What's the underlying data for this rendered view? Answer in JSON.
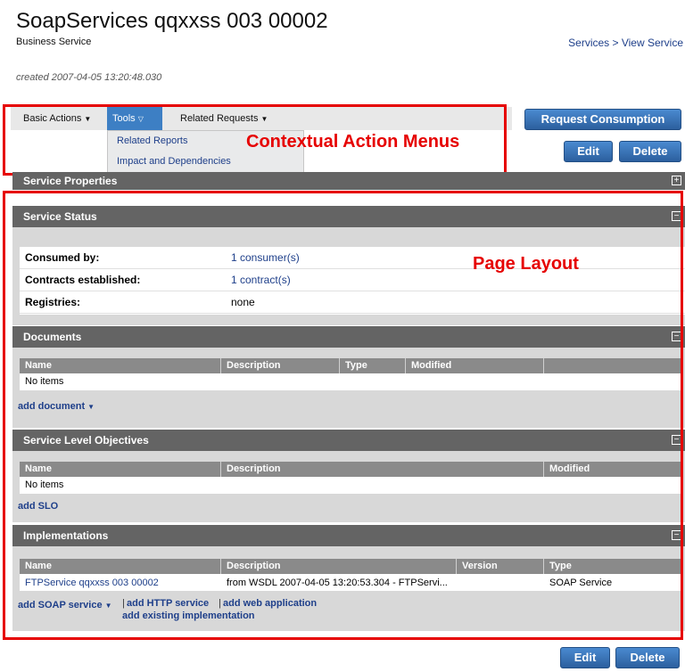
{
  "header": {
    "title": "SoapServices qqxxss 003 00002",
    "subtitle": "Business Service",
    "breadcrumb": "Services > View Service",
    "created": "created 2007-04-05 13:20:48.030"
  },
  "menus": {
    "basic_actions": "Basic Actions",
    "tools": "Tools",
    "related_requests": "Related Requests",
    "tools_items": [
      "Related Reports",
      "Impact and Dependencies"
    ]
  },
  "buttons": {
    "request_consumption": "Request Consumption",
    "edit": "Edit",
    "delete": "Delete"
  },
  "annotations": {
    "contextual": "Contextual Action Menus",
    "layout": "Page Layout"
  },
  "sections": {
    "service_properties": "Service Properties",
    "service_status": "Service Status",
    "documents": "Documents",
    "slo": "Service Level Objectives",
    "implementations": "Implementations"
  },
  "status": [
    {
      "key": "Consumed by:",
      "value": "1 consumer(s)"
    },
    {
      "key": "Contracts established:",
      "value": "1 contract(s)"
    },
    {
      "key": "Registries:",
      "value": "none"
    }
  ],
  "documents": {
    "columns": [
      "Name",
      "Description",
      "Type",
      "Modified"
    ],
    "empty": "No items",
    "add": "add document"
  },
  "slo": {
    "columns": [
      "Name",
      "Description",
      "Modified"
    ],
    "empty": "No items",
    "add": "add SLO"
  },
  "implementations": {
    "columns": [
      "Name",
      "Description",
      "Version",
      "Type"
    ],
    "rows": [
      {
        "name": "FTPService qqxxss 003 00002",
        "description": "from WSDL 2007-04-05 13:20:53.304 - FTPServi...",
        "version": "",
        "type": "SOAP Service"
      }
    ],
    "add_soap": "add SOAP service",
    "add_http": "add HTTP service",
    "add_web": "add web application",
    "add_existing": "add existing implementation",
    "separator": "|"
  },
  "colors": {
    "accent": "#3d7fc4",
    "section_header": "#646464",
    "annotation": "#e60000",
    "link": "#1e3f8a"
  }
}
